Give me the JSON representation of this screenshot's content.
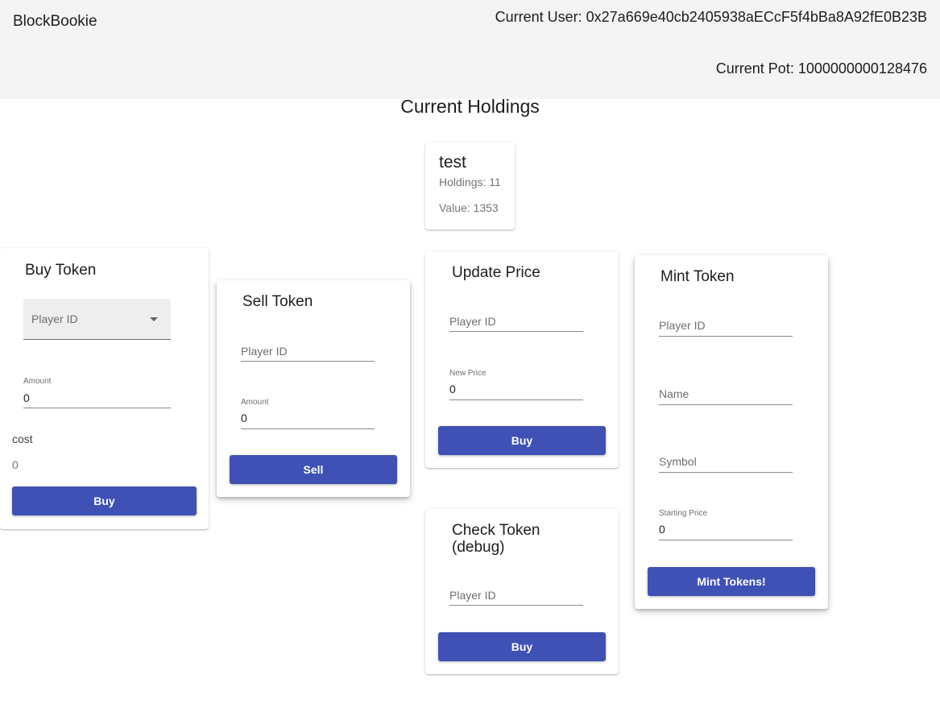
{
  "header": {
    "brand": "BlockBookie",
    "current_user": "Current User: 0x27a669e40cb2405938aECcF5f4bBa8A92fE0B23B",
    "current_pot": "Current Pot: 1000000000128476"
  },
  "holdings": {
    "title": "Current Holdings",
    "items": [
      {
        "name": "test",
        "holdings": "Holdings: 11",
        "value": "Value: 1353"
      }
    ]
  },
  "buy_token": {
    "title": "Buy Token",
    "player_select_placeholder": "Player ID",
    "amount_label": "Amount",
    "amount_value": "0",
    "cost_label": "cost",
    "cost_value": "0",
    "button": "Buy"
  },
  "sell_token": {
    "title": "Sell Token",
    "player_placeholder": "Player ID",
    "amount_label": "Amount",
    "amount_value": "0",
    "button": "Sell"
  },
  "update_price": {
    "title": "Update Price",
    "player_placeholder": "Player ID",
    "price_label": "New Price",
    "price_value": "0",
    "button": "Buy"
  },
  "check_token": {
    "title_line1": "Check Token",
    "title_line2": "(debug)",
    "player_placeholder": "Player ID",
    "button": "Buy"
  },
  "mint_token": {
    "title": "Mint Token",
    "player_placeholder": "Player ID",
    "name_placeholder": "Name",
    "symbol_placeholder": "Symbol",
    "price_label": "Starting Price",
    "price_value": "0",
    "button": "Mint Tokens!"
  },
  "colors": {
    "primary": "#3f51b5",
    "appbar": "#f4f4f4"
  },
  "icons": {
    "select_caret": "arrow-drop-down-icon"
  }
}
